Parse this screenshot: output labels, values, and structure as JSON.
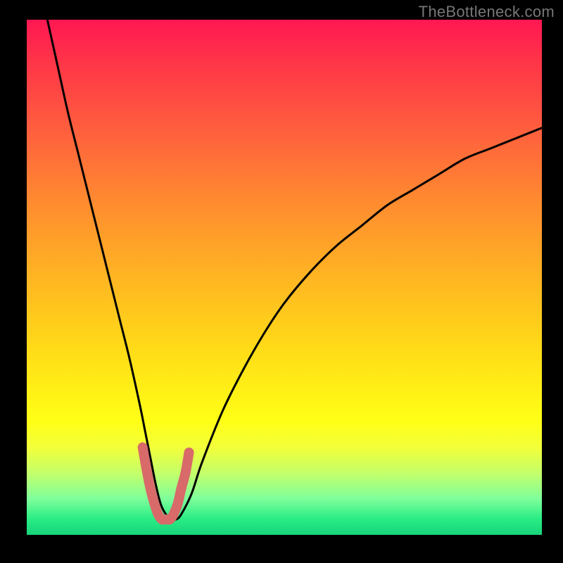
{
  "watermark": "TheBottleneck.com",
  "chart_data": {
    "type": "line",
    "title": "",
    "xlabel": "",
    "ylabel": "",
    "xlim": [
      0,
      100
    ],
    "ylim": [
      0,
      100
    ],
    "series": [
      {
        "name": "bottleneck-curve",
        "x": [
          4,
          6,
          8,
          10,
          12,
          14,
          16,
          18,
          20,
          22,
          23,
          24,
          25,
          26,
          27,
          28,
          29,
          30,
          32,
          34,
          38,
          42,
          46,
          50,
          55,
          60,
          65,
          70,
          75,
          80,
          85,
          90,
          95,
          100
        ],
        "values": [
          100,
          91,
          82,
          74,
          66,
          58,
          50,
          42,
          34,
          25,
          20,
          15,
          10,
          6,
          4,
          3,
          3,
          4,
          8,
          14,
          24,
          32,
          39,
          45,
          51,
          56,
          60,
          64,
          67,
          70,
          73,
          75,
          77,
          79
        ]
      },
      {
        "name": "highlight-region",
        "x": [
          22.5,
          23.2,
          24.0,
          24.8,
          25.5,
          26.2,
          27.0,
          27.8,
          28.5,
          29.3,
          30.0,
          30.8,
          31.5
        ],
        "values": [
          17,
          13,
          9,
          6,
          4,
          3,
          3,
          3,
          4,
          6,
          9,
          12,
          16
        ]
      }
    ],
    "colors": {
      "curve": "#000000",
      "highlight": "#d86a6a"
    }
  }
}
